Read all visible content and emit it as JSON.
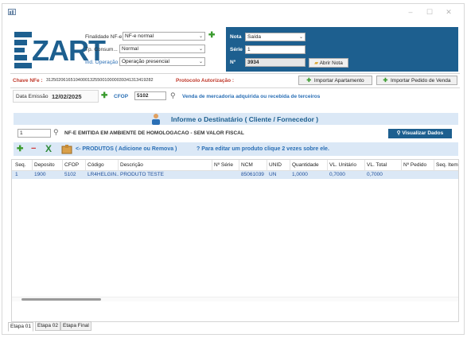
{
  "header": {
    "finalidade_label": "Finalidade NF-e",
    "finalidade_value": "NF-e normal",
    "tp_consumo_label": "Tp. Consum...",
    "tp_consumo_value": "Normal",
    "ind_operacao_label": "Ind. Operação",
    "ind_operacao_value": "Operação presencial",
    "logo_text": "ZART"
  },
  "nota": {
    "nota_label": "Nota",
    "nota_value": "Saída",
    "serie_label": "Série",
    "serie_value": "1",
    "numero_label": "Nº",
    "numero_value": "3934",
    "abrir_nota_label": "Abrir Nota"
  },
  "chave": {
    "label": "Chave NFe :",
    "value": "31250206165104000132550010000039341313419282",
    "protocolo_label": "Protocolo Autorização :",
    "importar_apartamento": "Importar Apartamento",
    "importar_pedido": "Importar Pedido de Venda"
  },
  "emissao": {
    "data_label": "Data Emissão",
    "data_value": "12/02/2025",
    "cfop_label": "CFOP",
    "cfop_value": "5102",
    "cfop_desc": "Venda de mercadoria adquirida ou recebida de terceiros"
  },
  "destinatario": {
    "banner": "Informe o Destinatário ( Cliente / Fornecedor )",
    "code_value": "1",
    "name": "NF-E EMITIDA EM AMBIENTE DE HOMOLOGACAO - SEM VALOR FISCAL",
    "visualizar_label": "Visualizar Dados"
  },
  "produtos": {
    "toolbar_text": "<-  PRODUTOS ( Adicione ou Remova )",
    "hint_text": "? Para editar um produto clique 2 vezes sobre ele.",
    "columns": [
      "Seq.",
      "Deposito",
      "CFOP",
      "Código",
      "Descrição",
      "Nº Série",
      "NCM",
      "UNID",
      "Quantidade",
      "VL. Unitário",
      "VL. Total",
      "Nº Pedido",
      "Seq. Item"
    ],
    "rows": [
      [
        "1",
        "1900",
        "5102",
        "LR4HELGIN...",
        "PRODUTO TESTE",
        "",
        "85061039",
        "UN",
        "1,0000",
        "0,7000",
        "0,7000",
        "",
        ""
      ]
    ]
  },
  "tabs": [
    "Etapa 01",
    "Etapa 02",
    "Etapa Final"
  ],
  "colors": {
    "panel_blue": "#1d5f8f",
    "banner_blue": "#dbe8f6",
    "label_red": "#c0392b",
    "link_blue": "#2a6fb5",
    "green": "#3a9b2e"
  }
}
